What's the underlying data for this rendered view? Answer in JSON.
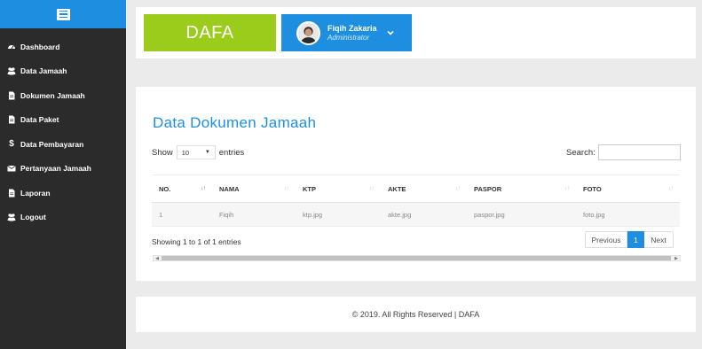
{
  "sidebar": {
    "items": [
      {
        "label": "Dashboard",
        "icon": "dashboard-icon"
      },
      {
        "label": "Data Jamaah",
        "icon": "users-icon"
      },
      {
        "label": "Dokumen Jamaah",
        "icon": "file-icon"
      },
      {
        "label": "Data Paket",
        "icon": "file-icon"
      },
      {
        "label": "Data Pembayaran",
        "icon": "dollar-icon"
      },
      {
        "label": "Pertanyaan Jamaah",
        "icon": "envelope-icon"
      },
      {
        "label": "Laporan",
        "icon": "file-icon"
      },
      {
        "label": "Logout",
        "icon": "users-icon"
      }
    ]
  },
  "header": {
    "brand": "DAFA",
    "user_name": "Fiqih Zakaria",
    "user_role": "Administrator"
  },
  "main": {
    "title": "Data Dokumen Jamaah",
    "show_label": "Show",
    "entries_value": "10",
    "entries_label": "entries",
    "search_label": "Search:",
    "search_value": "",
    "columns": [
      "NO.",
      "NAMA",
      "KTP",
      "AKTE",
      "PASPOR",
      "FOTO"
    ],
    "rows": [
      [
        "1",
        "Fiqih",
        "ktp.jpg",
        "akte.jpg",
        "paspor.jpg",
        "foto.jpg"
      ]
    ],
    "info": "Showing 1 to 1 of 1 entries",
    "pagination": {
      "previous": "Previous",
      "current": "1",
      "next": "Next"
    }
  },
  "footer": {
    "text": "© 2019. All Rights Reserved | DAFA"
  },
  "colors": {
    "accent": "#1e8fe0",
    "brand": "#9ccc1b",
    "sidebar": "#2b2b2b"
  }
}
